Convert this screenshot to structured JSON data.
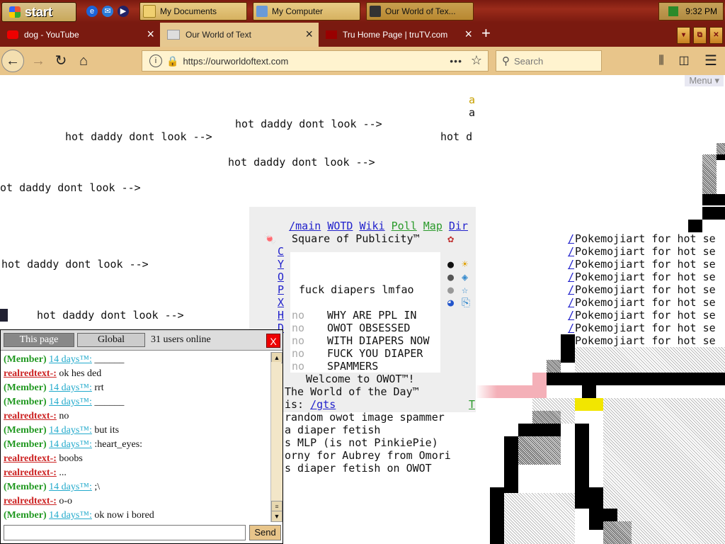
{
  "taskbar": {
    "start_label": "start",
    "tasks": [
      {
        "label": "My Documents"
      },
      {
        "label": "My Computer"
      },
      {
        "label": "Our World of Tex..."
      }
    ],
    "clock": "9:32 PM"
  },
  "browser": {
    "tabs": [
      {
        "label": "dog - YouTube",
        "active": false
      },
      {
        "label": "Our World of Text",
        "active": true
      },
      {
        "label": "Tru Home Page | truTV.com",
        "active": false
      }
    ],
    "url": "https://ourworldoftext.com",
    "search_placeholder": "Search"
  },
  "page": {
    "menu_label": "Menu ▾",
    "world_lines": {
      "a1": "a",
      "a2": "a",
      "hot_daddy": "hot daddy dont look -->",
      "hot_d": "hot d",
      "hot_partial": "ot daddy dont look -->"
    },
    "nav_links": [
      "/main",
      "WOTD",
      "Wiki",
      "Poll",
      "Map",
      "Dir"
    ],
    "square_title": "Square of Publicity™",
    "left_letters": [
      "C",
      "Y",
      "O",
      "P",
      "X",
      "H",
      "D"
    ],
    "inner_main": "fuck diapers lmfao",
    "inner_lines": [
      "WHY ARE PPL IN",
      "OWOT OBSESSED",
      "WITH DIAPERS NOW",
      "FUCK YOU DIAPER",
      "SPAMMERS"
    ],
    "no_word": "no",
    "welcome": "Welcome to OWOT™!",
    "wotd_line1": "The World of the Day™",
    "wotd_is": "is: ",
    "wotd_link": "/gts",
    "wotd_t": "T",
    "lower_lines": [
      "random owot image spammer",
      "a diaper fetish",
      "s MLP (is not PinkiePie)",
      "orny for Aubrey from Omori",
      "s diaper fetish on OWOT"
    ],
    "poke_slash": "/",
    "poke_line": "Pokemojiart for hot se",
    "poke_count": 9
  },
  "chat": {
    "tab_page": "This page",
    "tab_global": "Global",
    "users_online": "31 users online",
    "close_label": "X",
    "send_label": "Send",
    "input_value": "",
    "messages": [
      {
        "nick": "(Member)",
        "tag": "14 days™",
        "text": "______"
      },
      {
        "nick": "realredtext-:",
        "tag": "",
        "text": "ok hes ded"
      },
      {
        "nick": "(Member)",
        "tag": "14 days™",
        "text": "rrt"
      },
      {
        "nick": "(Member)",
        "tag": "14 days™",
        "text": "______"
      },
      {
        "nick": "realredtext-:",
        "tag": "",
        "text": "no"
      },
      {
        "nick": "(Member)",
        "tag": "14 days™",
        "text": "but its"
      },
      {
        "nick": "(Member)",
        "tag": "14 days™",
        "text": ":heart_eyes:"
      },
      {
        "nick": "realredtext-:",
        "tag": "",
        "text": "boobs"
      },
      {
        "nick": "realredtext-:",
        "tag": "",
        "text": "..."
      },
      {
        "nick": "(Member)",
        "tag": "14 days™",
        "text": ";\\"
      },
      {
        "nick": "realredtext-:",
        "tag": "",
        "text": "o-o"
      },
      {
        "nick": "(Member)",
        "tag": "14 days™",
        "text": "ok now i bored"
      }
    ]
  }
}
